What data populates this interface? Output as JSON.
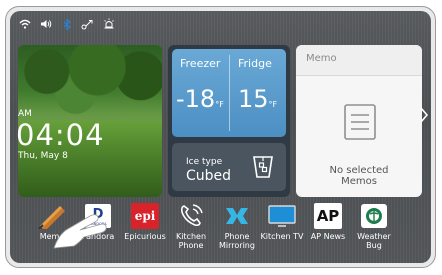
{
  "status_icons": [
    "wifi-icon",
    "speaker-icon",
    "bluetooth-icon",
    "share-icon",
    "alarm-icon"
  ],
  "clock": {
    "ampm": "AM",
    "time": "04:04",
    "date": "Thu, May 8"
  },
  "fridge": {
    "freezer_label": "Freezer",
    "fridge_label": "Fridge",
    "freezer_temp": "-18",
    "fridge_temp": "15",
    "unit": "°F",
    "ice_label": "Ice type",
    "ice_value": "Cubed"
  },
  "memo": {
    "title": "Memo",
    "empty_line1": "No selected",
    "empty_line2": "Memos"
  },
  "apps": [
    {
      "label": "Memo",
      "icon": "pencil-icon"
    },
    {
      "label": "Pandora",
      "icon": "pandora-icon"
    },
    {
      "label": "Epicurious",
      "icon": "epicurious-icon",
      "text": "epi"
    },
    {
      "label": "Kitchen Phone",
      "line1": "Kitchen",
      "line2": "Phone",
      "icon": "phone-icon"
    },
    {
      "label": "Phone Mirroring",
      "line1": "Phone",
      "line2": "Mirroring",
      "icon": "mirroring-icon"
    },
    {
      "label": "Kitchen TV",
      "icon": "tv-icon"
    },
    {
      "label": "AP News",
      "icon": "ap-news-icon",
      "text": "AP"
    },
    {
      "label": "Weather Bug",
      "line1": "Weather",
      "line2": "Bug",
      "icon": "weatherbug-icon"
    }
  ],
  "colors": {
    "accent": "#2fa4e0",
    "fridge_blue": "#5a9dd0",
    "epi_red": "#d8232a"
  }
}
